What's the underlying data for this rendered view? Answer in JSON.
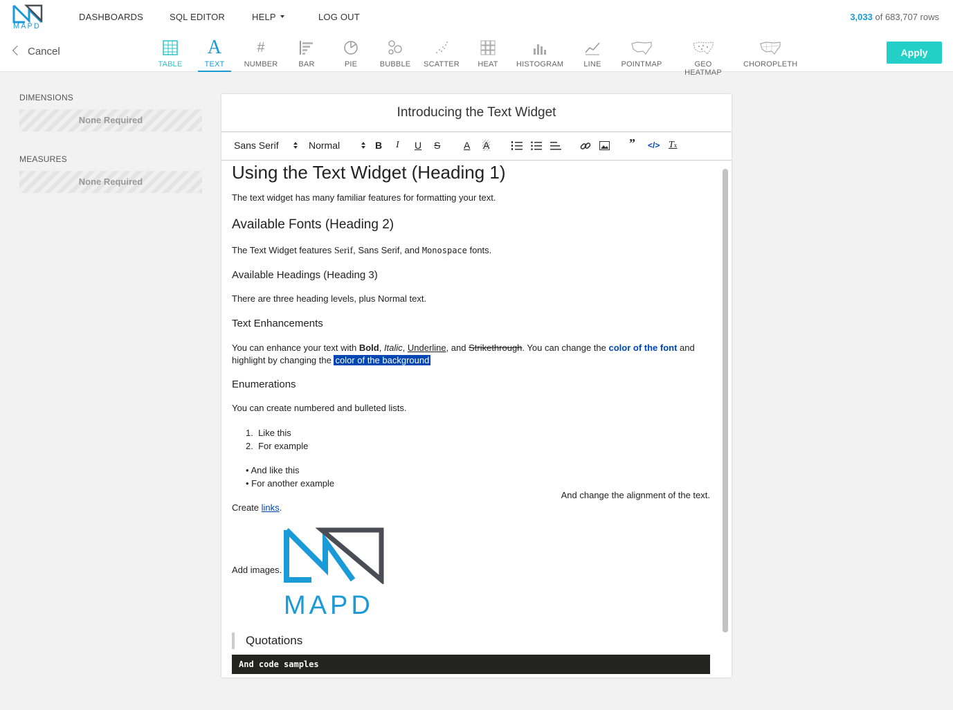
{
  "brand": {
    "logo_text": "MAPD"
  },
  "nav": {
    "dashboards": "DASHBOARDS",
    "sql_editor": "SQL EDITOR",
    "help": "HELP",
    "logout": "LOG OUT"
  },
  "rows": {
    "count": "3,033",
    "total": "of 683,707 rows"
  },
  "toolbar": {
    "cancel": "Cancel",
    "apply": "Apply",
    "chart_types": [
      "TABLE",
      "TEXT",
      "NUMBER",
      "BAR",
      "PIE",
      "BUBBLE",
      "SCATTER",
      "HEAT",
      "HISTOGRAM",
      "LINE",
      "POINTMAP",
      "GEO HEATMAP",
      "CHOROPLETH"
    ]
  },
  "sidebar": {
    "dimensions_title": "DIMENSIONS",
    "dimensions_value": "None Required",
    "measures_title": "MEASURES",
    "measures_value": "None Required"
  },
  "editor": {
    "title": "Introducing the Text Widget",
    "font_select": "Sans Serif",
    "size_select": "Normal",
    "h1": "Using the Text Widget (Heading 1)",
    "p1": "The text widget has many familiar features for formatting your text.",
    "h2": "Available Fonts (Heading 2)",
    "p2_a": "The Text Widget features ",
    "p2_serif": "Serif",
    "p2_b": ", Sans Serif, and ",
    "p2_mono": "Monospace",
    "p2_c": " fonts.",
    "h3": "Available Headings (Heading 3)",
    "p3": "There are three heading levels, plus Normal text.",
    "h4": "Text Enhancements",
    "p4_a": "You can enhance your text with ",
    "p4_bold": "Bold",
    "p4_comma1": ", ",
    "p4_italic": "Italic",
    "p4_comma2": ", ",
    "p4_underline": "Underline",
    "p4_and": ", and ",
    "p4_strike": "Strikethrough",
    "p4_b": ". You can change the ",
    "p4_colorfont": "color of the font",
    "p4_c": " and",
    "p4_d": "highlight by changing the ",
    "p4_colorbg": "color of the background",
    "h5": "Enumerations",
    "p5": "You can create numbered and bulleted lists.",
    "ol": [
      "Like this",
      "For example"
    ],
    "ul": [
      "And like this",
      "For another example"
    ],
    "right_aligned": "And change the alignment of the text.",
    "create": "Create ",
    "links": "links",
    "period": ".",
    "add_images": "Add images.",
    "image_logo_text": "MAPD",
    "quote": "Quotations",
    "code": "And code samples"
  },
  "colors": {
    "accent": "#1a9ad6",
    "apply": "#22d0c8",
    "active_tab": "#29c4c8",
    "font_color": "#0047b3"
  }
}
